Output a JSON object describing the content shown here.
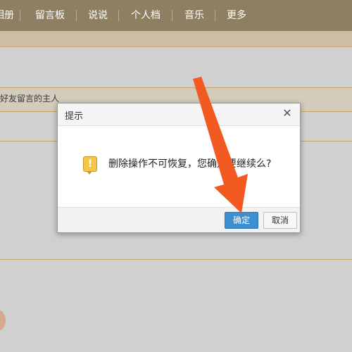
{
  "nav": {
    "items": [
      "相册",
      "留言板",
      "说说",
      "个人档",
      "音乐",
      "更多"
    ],
    "bg_color": "#8e7f62"
  },
  "page": {
    "notice_text": "好友留言的主人",
    "accent_line_color": "#c8a56f"
  },
  "dialog": {
    "title": "提示",
    "close_icon": "close-icon",
    "warning_icon": "exclamation-icon",
    "message": "删除操作不可恢复，您确定要继续么?",
    "confirm_label": "确定",
    "cancel_label": "取消",
    "confirm_color": "#3d8fd0"
  },
  "annotation": {
    "arrow_color": "#f25a22"
  }
}
